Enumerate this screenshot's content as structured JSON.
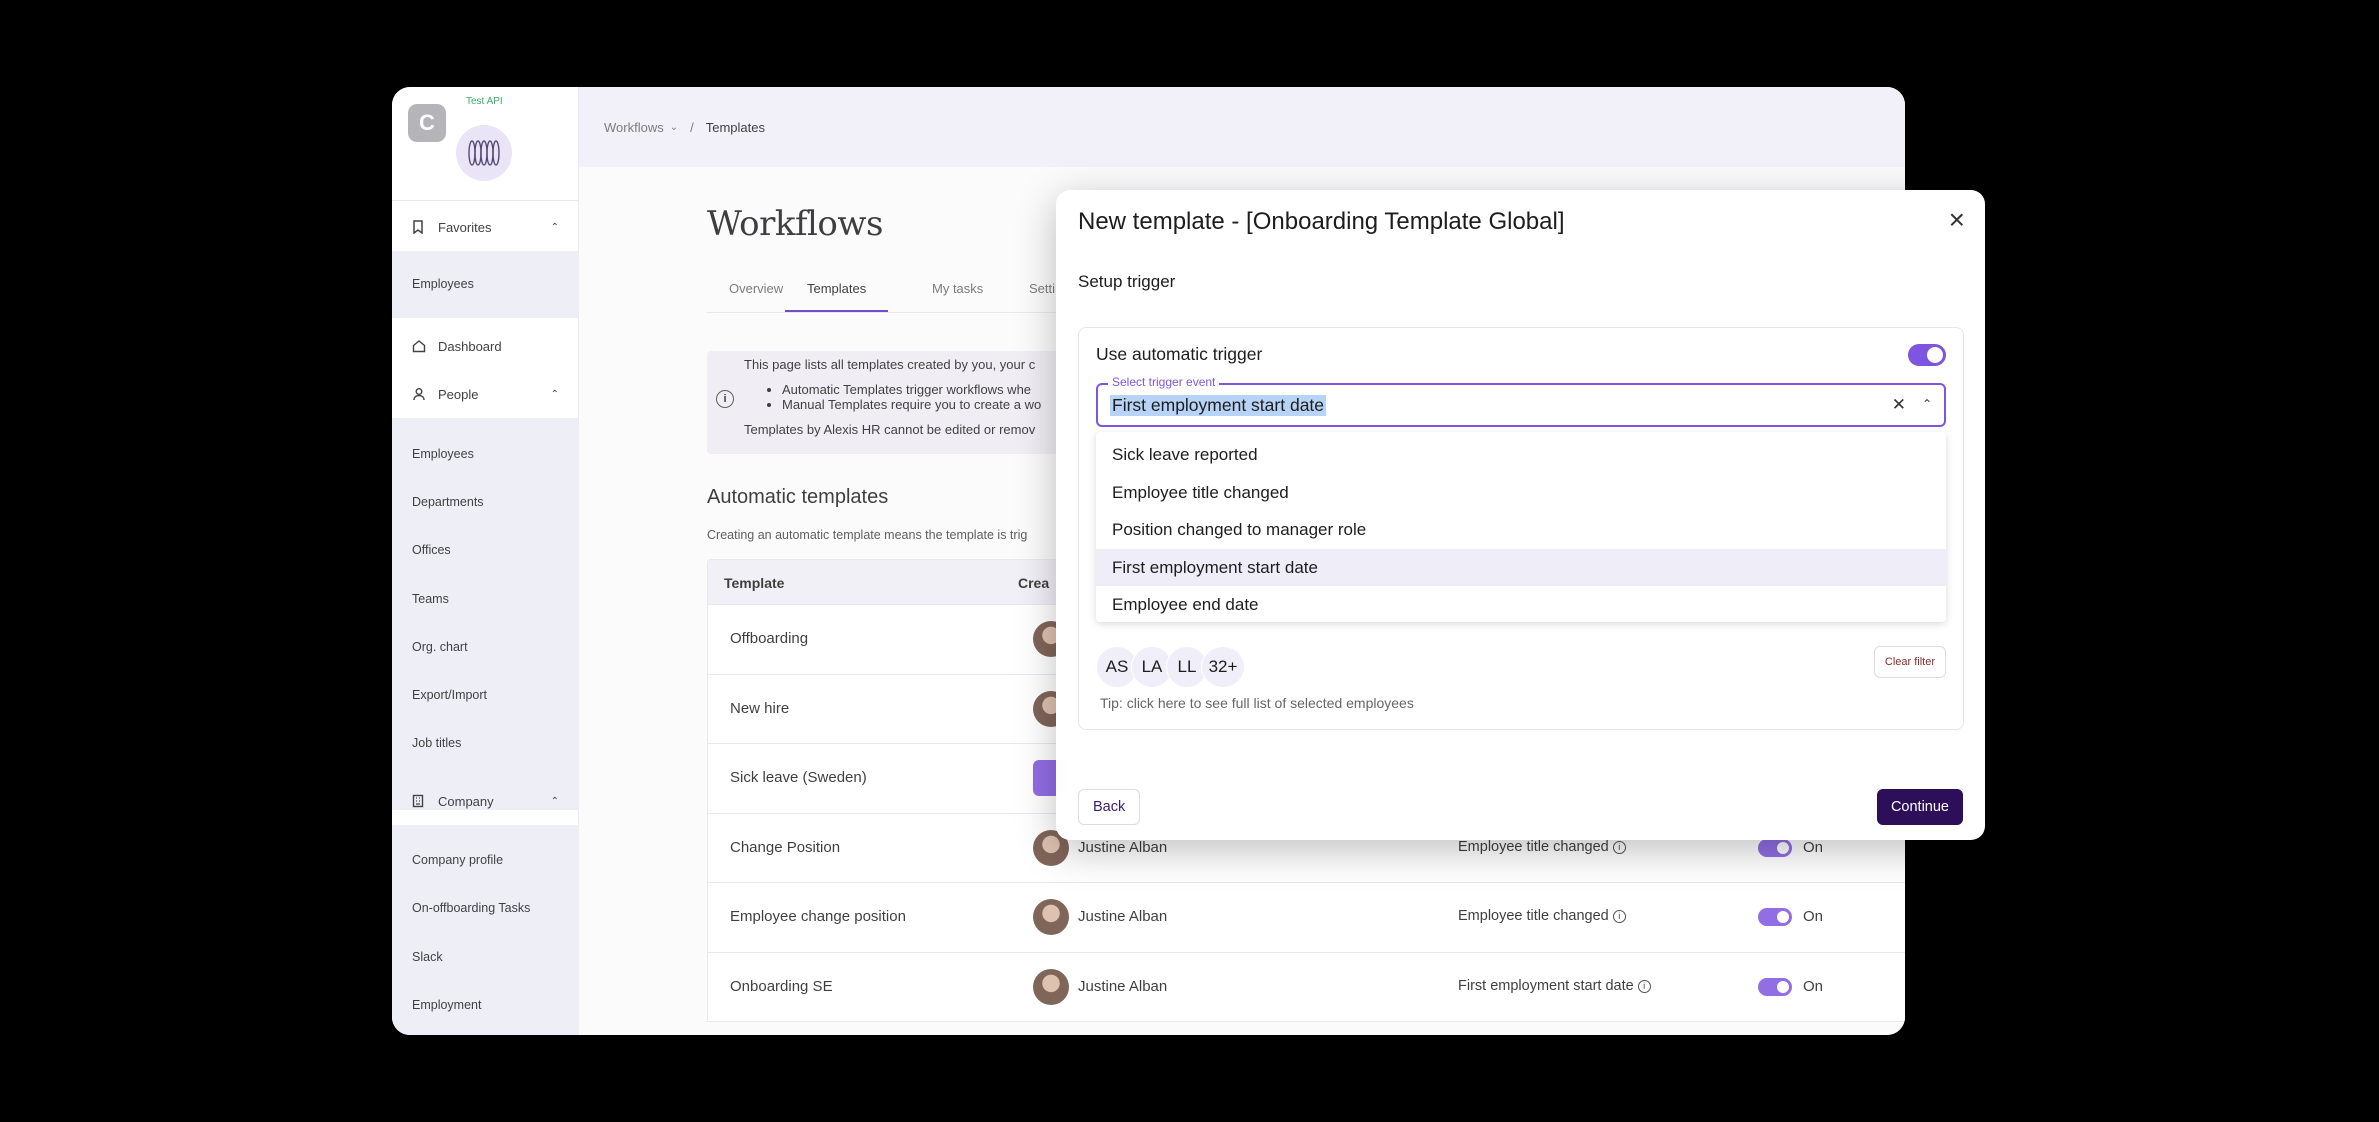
{
  "sidebar": {
    "api_label": "Test API",
    "logo_glyph": "C",
    "favorites_label": "Favorites",
    "favorites_items": [
      "Employees"
    ],
    "dashboard_label": "Dashboard",
    "people_label": "People",
    "people_items": [
      "Employees",
      "Departments",
      "Offices",
      "Teams",
      "Org. chart",
      "Export/Import",
      "Job titles"
    ],
    "company_label": "Company",
    "company_items": [
      "Company profile",
      "On-offboarding Tasks",
      "Slack",
      "Employment"
    ]
  },
  "breadcrumb": {
    "root": "Workflows",
    "separator": "/",
    "current": "Templates"
  },
  "page": {
    "title": "Workflows",
    "tabs": [
      "Overview",
      "Templates",
      "My tasks",
      "Setti"
    ],
    "active_tab": "Templates"
  },
  "info": {
    "line1": "This page lists all templates created by you, your c",
    "bullets": [
      "Automatic Templates trigger workflows whe",
      "Manual Templates require you to create a wo"
    ],
    "line2": "Templates by Alexis HR cannot be edited or remov"
  },
  "automatic": {
    "title": "Automatic templates",
    "desc": "Creating an automatic template means the template is trig"
  },
  "table": {
    "headers": [
      "Template",
      "Crea"
    ],
    "rows": [
      {
        "name": "Offboarding",
        "creator": "",
        "trigger": "",
        "state": ""
      },
      {
        "name": "New hire",
        "creator": "",
        "trigger": "",
        "state": ""
      },
      {
        "name": "Sick leave (Sweden)",
        "creator": "",
        "trigger": "",
        "state": ""
      },
      {
        "name": "Change Position",
        "creator": "Justine Alban",
        "trigger": "Employee title changed",
        "state": "On"
      },
      {
        "name": "Employee change position",
        "creator": "Justine Alban",
        "trigger": "Employee title changed",
        "state": "On"
      },
      {
        "name": "Onboarding SE",
        "creator": "Justine Alban",
        "trigger": "First employment start date",
        "state": "On"
      }
    ]
  },
  "modal": {
    "title": "New template - [Onboarding Template Global]",
    "subtitle": "Setup trigger",
    "auto_trigger_label": "Use automatic trigger",
    "select_label": "Select trigger event",
    "select_value": "First employment start date",
    "options": [
      "Sick leave reported",
      "Employee title changed",
      "Position changed to manager role",
      "First employment start date",
      "Employee end date"
    ],
    "selected_option": "First employment start date",
    "chips": [
      "AS",
      "LA",
      "LL",
      "32+"
    ],
    "clear_filter": "Clear filter",
    "tip": "Tip: click here to see full list of selected employees",
    "back": "Back",
    "continue": "Continue"
  },
  "colors": {
    "accent": "#7e55e0",
    "primary_button": "#2c0e59",
    "api_green": "#18a058"
  }
}
